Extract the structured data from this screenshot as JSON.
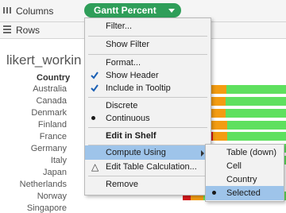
{
  "shelves": {
    "columns_label": "Columns",
    "rows_label": "Rows",
    "column_pill": "Gantt Percent"
  },
  "sheet": {
    "title": "likert_workin",
    "row_header": "Country",
    "countries": [
      "Australia",
      "Canada",
      "Denmark",
      "Finland",
      "France",
      "Germany",
      "Italy",
      "Japan",
      "Netherlands",
      "Norway",
      "Singapore"
    ]
  },
  "colors": {
    "pill": "#2f9e59",
    "red": "#d7191c",
    "orange": "#f39c12",
    "green": "#5fe05f",
    "menu_highlight": "#9ec4ea"
  },
  "context_menu": {
    "filter": "Filter...",
    "show_filter": "Show Filter",
    "format": "Format...",
    "show_header": "Show Header",
    "include_tooltip": "Include in Tooltip",
    "discrete": "Discrete",
    "continuous": "Continuous",
    "edit_in_shelf": "Edit in Shelf",
    "compute_using": "Compute Using",
    "edit_table_calc": "Edit Table Calculation...",
    "remove": "Remove"
  },
  "compute_submenu": {
    "table_down": "Table (down)",
    "cell": "Cell",
    "country": "Country",
    "selected": "Selected"
  }
}
